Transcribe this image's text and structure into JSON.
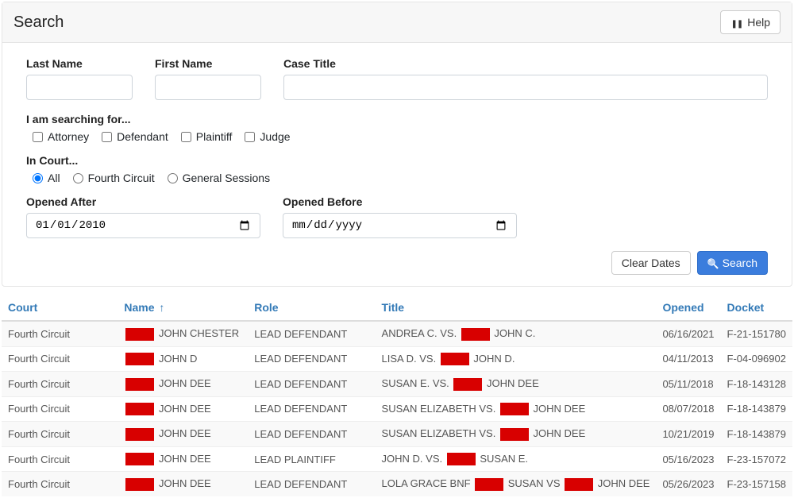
{
  "header": {
    "title": "Search",
    "help_label": "Help"
  },
  "form": {
    "labels": {
      "last_name": "Last Name",
      "first_name": "First Name",
      "case_title": "Case Title",
      "searching_for": "I am searching for...",
      "in_court": "In Court...",
      "opened_after": "Opened After",
      "opened_before": "Opened Before",
      "clear_dates": "Clear Dates",
      "search_btn": "Search"
    },
    "values": {
      "last_name": "",
      "first_name": "",
      "case_title": "",
      "opened_after": "2010-01-01",
      "opened_before": ""
    },
    "placeholders": {
      "opened_before": "mm/dd/yyyy"
    },
    "checkboxes": {
      "attorney": "Attorney",
      "defendant": "Defendant",
      "plaintiff": "Plaintiff",
      "judge": "Judge"
    },
    "radios": {
      "all": "All",
      "fourth": "Fourth Circuit",
      "general": "General Sessions"
    }
  },
  "table": {
    "headers": {
      "court": "Court",
      "name": "Name",
      "role": "Role",
      "title": "Title",
      "opened": "Opened",
      "docket": "Docket"
    },
    "rows": [
      {
        "court": "Fourth Circuit",
        "name_suffix": "JOHN CHESTER",
        "role": "LEAD DEFENDANT",
        "title_pre": "ANDREA C. VS. ",
        "title_post": " JOHN C.",
        "opened": "06/16/2021",
        "docket": "F-21-151780"
      },
      {
        "court": "Fourth Circuit",
        "name_suffix": "JOHN D",
        "role": "LEAD DEFENDANT",
        "title_pre": "LISA D. VS. ",
        "title_post": " JOHN D.",
        "opened": "04/11/2013",
        "docket": "F-04-096902"
      },
      {
        "court": "Fourth Circuit",
        "name_suffix": "JOHN DEE",
        "role": "LEAD DEFENDANT",
        "title_pre": "SUSAN E. VS. ",
        "title_post": " JOHN DEE",
        "opened": "05/11/2018",
        "docket": "F-18-143128"
      },
      {
        "court": "Fourth Circuit",
        "name_suffix": "JOHN DEE",
        "role": "LEAD DEFENDANT",
        "title_pre": "SUSAN ELIZABETH VS. ",
        "title_post": " JOHN DEE",
        "opened": "08/07/2018",
        "docket": "F-18-143879"
      },
      {
        "court": "Fourth Circuit",
        "name_suffix": "JOHN DEE",
        "role": "LEAD DEFENDANT",
        "title_pre": "SUSAN ELIZABETH VS. ",
        "title_post": " JOHN DEE",
        "opened": "10/21/2019",
        "docket": "F-18-143879"
      },
      {
        "court": "Fourth Circuit",
        "name_suffix": "JOHN DEE",
        "role": "LEAD PLAINTIFF",
        "title_pre": "JOHN D. VS. ",
        "title_post": " SUSAN E.",
        "opened": "05/16/2023",
        "docket": "F-23-157072"
      },
      {
        "court": "Fourth Circuit",
        "name_suffix": "JOHN DEE",
        "role": "LEAD DEFENDANT",
        "title_pre": "LOLA GRACE BNF ",
        "title_mid": " SUSAN VS ",
        "title_post": " JOHN DEE",
        "opened": "05/26/2023",
        "docket": "F-23-157158"
      }
    ]
  }
}
